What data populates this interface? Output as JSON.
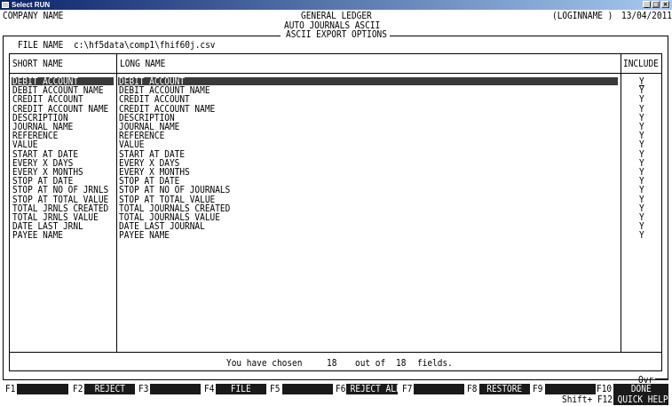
{
  "window": {
    "title": "Select RUN"
  },
  "header": {
    "company": "COMPANY NAME",
    "module": "GENERAL LEDGER",
    "submodule": "AUTO JOURNALS ASCII",
    "screen": "ASCII EXPORT OPTIONS",
    "login": "(LOGINNAME )",
    "date": "13/04/2011"
  },
  "file": {
    "label": "FILE NAME",
    "value": "c:\\hf5data\\comp1\\fhif60j.csv"
  },
  "columns": {
    "short": "SHORT NAME",
    "long": "LONG NAME",
    "include": "INCLUDE"
  },
  "fields": [
    {
      "short": "DEBIT ACCOUNT",
      "long": "DEBIT ACCOUNT",
      "include": "Y"
    },
    {
      "short": "DEBIT ACCOUNT NAME",
      "long": "DEBIT ACCOUNT NAME",
      "include": "Y"
    },
    {
      "short": "CREDIT ACCOUNT",
      "long": "CREDIT ACCOUNT",
      "include": "Y"
    },
    {
      "short": "CREDIT ACCOUNT NAME",
      "long": "CREDIT ACCOUNT NAME",
      "include": "Y"
    },
    {
      "short": "DESCRIPTION",
      "long": "DESCRIPTION",
      "include": "Y"
    },
    {
      "short": "JOURNAL NAME",
      "long": "JOURNAL NAME",
      "include": "Y"
    },
    {
      "short": "REFERENCE",
      "long": "REFERENCE",
      "include": "Y"
    },
    {
      "short": "VALUE",
      "long": "VALUE",
      "include": "Y"
    },
    {
      "short": "START AT DATE",
      "long": "START AT DATE",
      "include": "Y"
    },
    {
      "short": "EVERY X DAYS",
      "long": "EVERY X DAYS",
      "include": "Y"
    },
    {
      "short": "EVERY X MONTHS",
      "long": "EVERY X MONTHS",
      "include": "Y"
    },
    {
      "short": "STOP AT DATE",
      "long": "STOP AT DATE",
      "include": "Y"
    },
    {
      "short": "STOP AT NO OF JRNLS",
      "long": "STOP AT NO OF JOURNALS",
      "include": "Y"
    },
    {
      "short": "STOP AT TOTAL VALUE",
      "long": "STOP AT TOTAL VALUE",
      "include": "Y"
    },
    {
      "short": "TOTAL JRNLS CREATED",
      "long": "TOTAL JOURNALS CREATED",
      "include": "Y"
    },
    {
      "short": "TOTAL JRNLS VALUE",
      "long": "TOTAL JOURNALS VALUE",
      "include": "Y"
    },
    {
      "short": "DATE LAST JRNL",
      "long": "DATE LAST JOURNAL",
      "include": "Y"
    },
    {
      "short": "PAYEE NAME",
      "long": "PAYEE NAME",
      "include": "Y"
    }
  ],
  "status": {
    "prefix": "You have chosen",
    "chosen": "18",
    "middle": "out of",
    "total": "18",
    "suffix": "fields."
  },
  "mode": "Ovr",
  "fkeys": [
    {
      "key": "F1",
      "label": ""
    },
    {
      "key": "F2",
      "label": "REJECT"
    },
    {
      "key": "F3",
      "label": ""
    },
    {
      "key": "F4",
      "label": "FILE"
    },
    {
      "key": "F5",
      "label": ""
    },
    {
      "key": "F6",
      "label": "REJECT ALL"
    },
    {
      "key": "F7",
      "label": ""
    },
    {
      "key": "F8",
      "label": "RESTORE"
    },
    {
      "key": "F9",
      "label": ""
    },
    {
      "key": "F10",
      "label": "DONE"
    }
  ],
  "shift_key": {
    "key": "Shift+ F12",
    "label": "QUICK HELP"
  }
}
